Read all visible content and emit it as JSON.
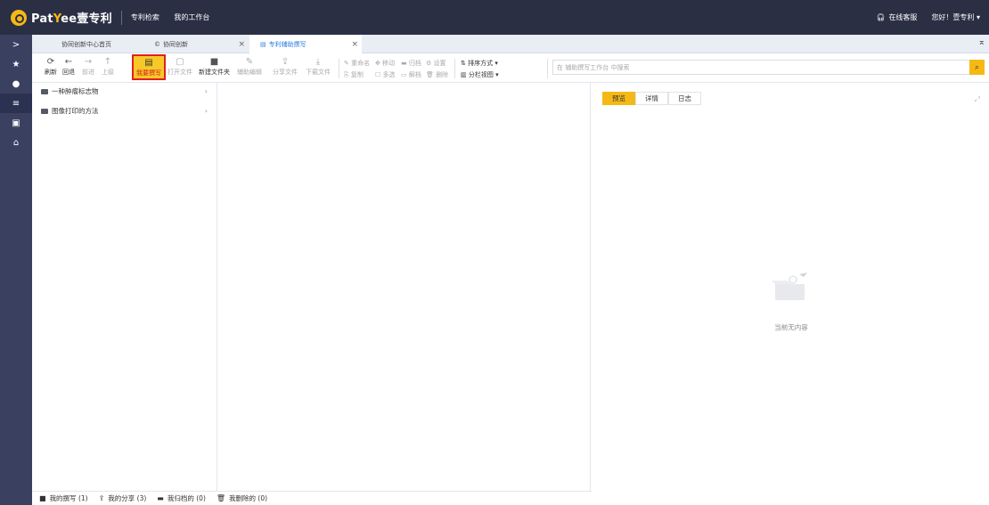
{
  "app": {
    "logo_pat": "Pat",
    "logo_y": "Y",
    "logo_ee": "ee",
    "logo_cn": "壹专利",
    "nav": [
      "专利检索",
      "我的工作台"
    ],
    "support": "在线客服",
    "greeting": "您好！壹专利 ▾"
  },
  "sidebar": {
    "items": [
      ">",
      "★",
      "●",
      "≡",
      "▣",
      "⌂"
    ]
  },
  "tabs": [
    {
      "label": "协同创新中心首页"
    },
    {
      "label": "协同创新"
    },
    {
      "label": "专利辅助撰写"
    }
  ],
  "toolbar": {
    "refresh": "刷新",
    "back": "回退",
    "forward": "前进",
    "up": "上级",
    "write": "我要撰写",
    "open_file": "打开文件",
    "new_folder": "新建文件夹",
    "assist_edit": "辅助编辑",
    "share_file": "分享文件",
    "download_file": "下载文件",
    "rename": "重命名",
    "move": "移动",
    "archive": "归档",
    "settings": "设置",
    "copy": "复制",
    "multi_select": "多选",
    "unpack": "解档",
    "delete": "删除",
    "sort": "排序方式 ▾",
    "split_view": "分栏视图 ▾",
    "search_placeholder": "在 辅助撰写工作台 中搜索"
  },
  "tree": {
    "items": [
      {
        "label": "一种肿瘤标志物"
      },
      {
        "label": "图像打印的方法"
      }
    ]
  },
  "preview": {
    "tabs": [
      "预览",
      "详情",
      "日志"
    ],
    "empty": "当前无内容"
  },
  "bottom": {
    "my_writing": "我的撰写 (1)",
    "my_share": "我的分享 (3)",
    "my_archive": "我归档的 (0)",
    "my_deleted": "我删除的 (0)"
  }
}
